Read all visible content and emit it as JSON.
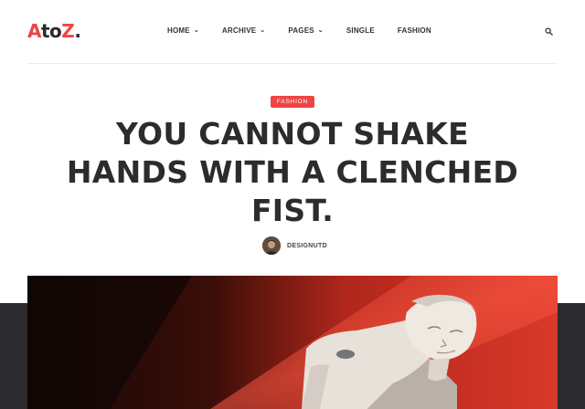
{
  "brand": {
    "logo_first": "A",
    "logo_mid": "to",
    "logo_last": "Z",
    "logo_dot": "."
  },
  "nav": {
    "items": [
      {
        "label": "HOME",
        "dropdown": true
      },
      {
        "label": "ARCHIVE",
        "dropdown": true
      },
      {
        "label": "PAGES",
        "dropdown": true
      },
      {
        "label": "SINGLE",
        "dropdown": false
      },
      {
        "label": "FASHION",
        "dropdown": false
      }
    ],
    "search_icon": "search-icon"
  },
  "post": {
    "category": "FASHION",
    "title": "YOU CANNOT SHAKE HANDS WITH A CLENCHED FIST.",
    "author": "DESIGNUTD"
  },
  "colors": {
    "accent": "#ef4444",
    "dark_band": "#2b2b2d",
    "text": "#2c2c2c"
  }
}
